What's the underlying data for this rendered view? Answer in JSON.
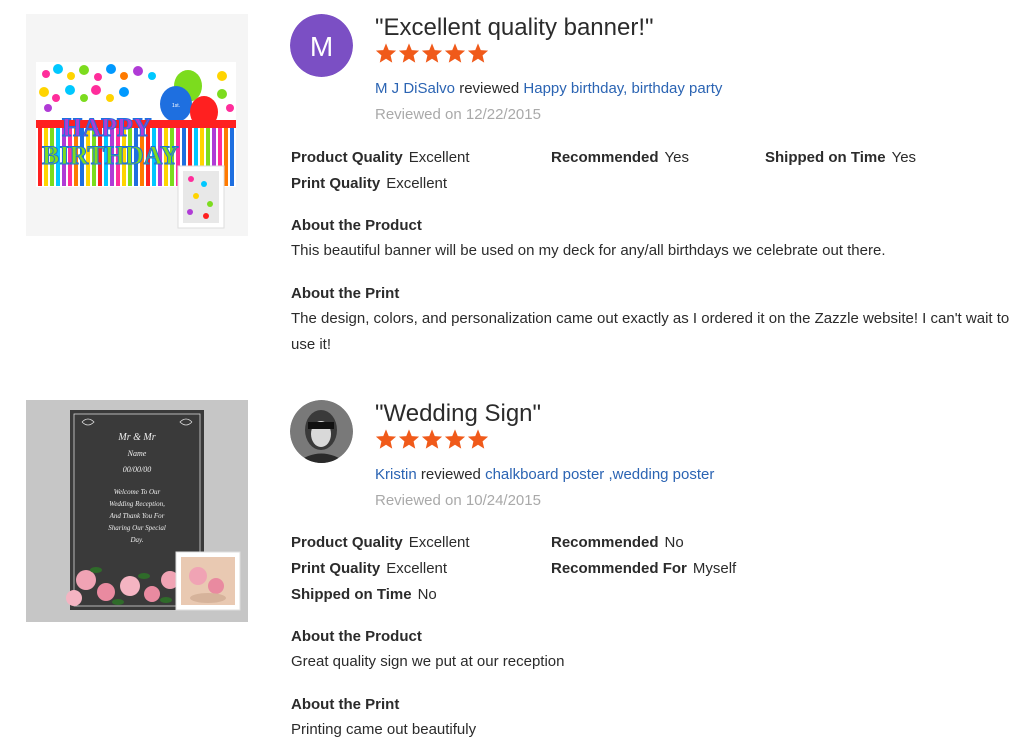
{
  "reviews": [
    {
      "avatar_letter": "M",
      "avatar_color": "#7b4fc4",
      "title": "\"Excellent quality banner!\"",
      "rating": 5,
      "reviewer": "M J DiSalvo",
      "reviewed_word": "reviewed",
      "product": "Happy birthday, birthday party",
      "date": "Reviewed on 12/22/2015",
      "attributes": [
        {
          "label": "Product Quality",
          "value": "Excellent"
        },
        {
          "label": "Recommended",
          "value": "Yes"
        },
        {
          "label": "Shipped on Time",
          "value": "Yes"
        },
        {
          "label": "Print Quality",
          "value": "Excellent"
        }
      ],
      "about_product_heading": "About the Product",
      "about_product": "This beautiful banner will be used on my deck for any/all birthdays we celebrate out there.",
      "about_print_heading": "About the Print",
      "about_print": "The design, colors, and personalization came out exactly as I ordered it on the Zazzle website! I can't wait to use it!",
      "product_image": {
        "word1": "HAPPY",
        "word2": "BIRTHDAY"
      }
    },
    {
      "title": "\"Wedding Sign\"",
      "rating": 5,
      "reviewer": "Kristin",
      "reviewed_word": "reviewed",
      "product": "chalkboard poster ,wedding poster",
      "date": "Reviewed on 10/24/2015",
      "attributes": [
        {
          "label": "Product Quality",
          "value": "Excellent"
        },
        {
          "label": "Recommended",
          "value": "No"
        },
        {
          "label": "Print Quality",
          "value": "Excellent"
        },
        {
          "label": "Recommended For",
          "value": "Myself"
        },
        {
          "label": "Shipped on Time",
          "value": "No"
        }
      ],
      "about_product_heading": "About the Product",
      "about_product": "Great quality sign we put at our reception",
      "about_print_heading": "About the Print",
      "about_print": "Printing came out beautifuly",
      "product_image": {
        "line1": "Mr & Mr",
        "line2": "Name",
        "line3": "00/00/00",
        "line4": "Welcome To Our",
        "line5": "Wedding Reception,",
        "line6": "And Thank You For",
        "line7": "Sharing Our Special",
        "line8": "Day."
      }
    }
  ],
  "star_color": "#f05a1a"
}
